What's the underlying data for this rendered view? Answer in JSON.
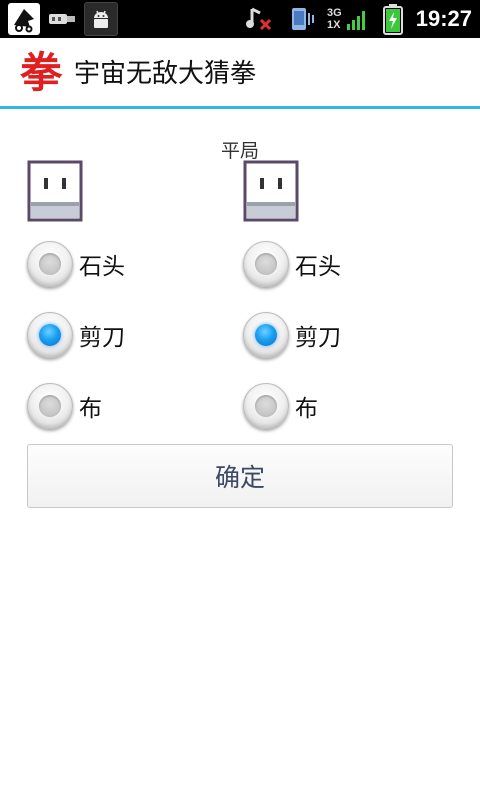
{
  "status_bar": {
    "time": "19:27",
    "network": [
      "3G",
      "1X"
    ],
    "left_icons": [
      "app-notification-icon",
      "usb-icon",
      "android-debug-icon"
    ],
    "right_icons": [
      "music-muted-icon",
      "vibrate-icon",
      "signal-icon",
      "battery-charging-icon"
    ]
  },
  "app": {
    "logo": "拳",
    "title": "宇宙无敌大猜拳"
  },
  "game": {
    "result": "平局",
    "left_player": {
      "options": [
        {
          "label": "石头",
          "checked": false
        },
        {
          "label": "剪刀",
          "checked": true
        },
        {
          "label": "布",
          "checked": false
        }
      ]
    },
    "right_player": {
      "options": [
        {
          "label": "石头",
          "checked": false
        },
        {
          "label": "剪刀",
          "checked": true
        },
        {
          "label": "布",
          "checked": false
        }
      ]
    },
    "confirm_label": "确定"
  },
  "colors": {
    "accent": "#33b5e5",
    "logo": "#e02020",
    "radio_selected": "#1aa0f0"
  }
}
